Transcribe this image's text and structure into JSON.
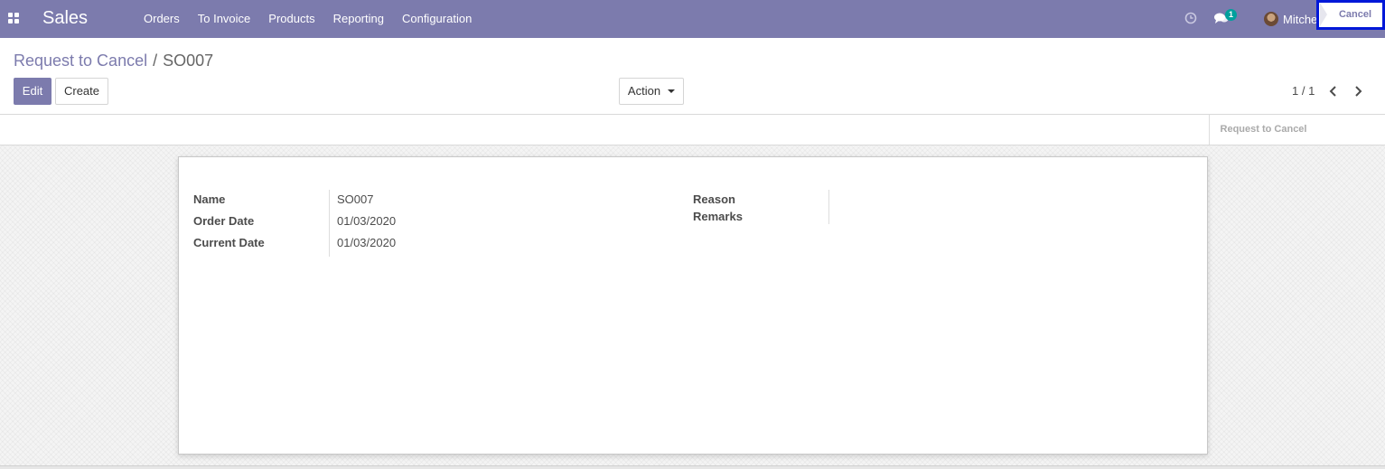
{
  "app": {
    "name": "Sales"
  },
  "menu": [
    {
      "label": "Orders"
    },
    {
      "label": "To Invoice"
    },
    {
      "label": "Products"
    },
    {
      "label": "Reporting"
    },
    {
      "label": "Configuration"
    }
  ],
  "systray": {
    "chat_count": "1",
    "user_name": "Mitchell Admin"
  },
  "breadcrumb": {
    "parent": "Request to Cancel",
    "separator": "/",
    "current": "SO007"
  },
  "buttons": {
    "edit": "Edit",
    "create": "Create",
    "action": "Action"
  },
  "pager": {
    "value": "1 / 1"
  },
  "status": {
    "request_to_cancel": "Request to Cancel",
    "cancel": "Cancel",
    "active": "Cancel"
  },
  "form": {
    "left": [
      {
        "label": "Name",
        "value": "SO007"
      },
      {
        "label": "Order Date",
        "value": "01/03/2020"
      },
      {
        "label": "Current Date",
        "value": "01/03/2020"
      }
    ],
    "right": [
      {
        "label": "Reason",
        "value": ""
      },
      {
        "label": "Remarks",
        "value": ""
      }
    ]
  },
  "colors": {
    "brand": "#7c7bad",
    "highlight": "#0018d8",
    "badge": "#00a09d"
  }
}
